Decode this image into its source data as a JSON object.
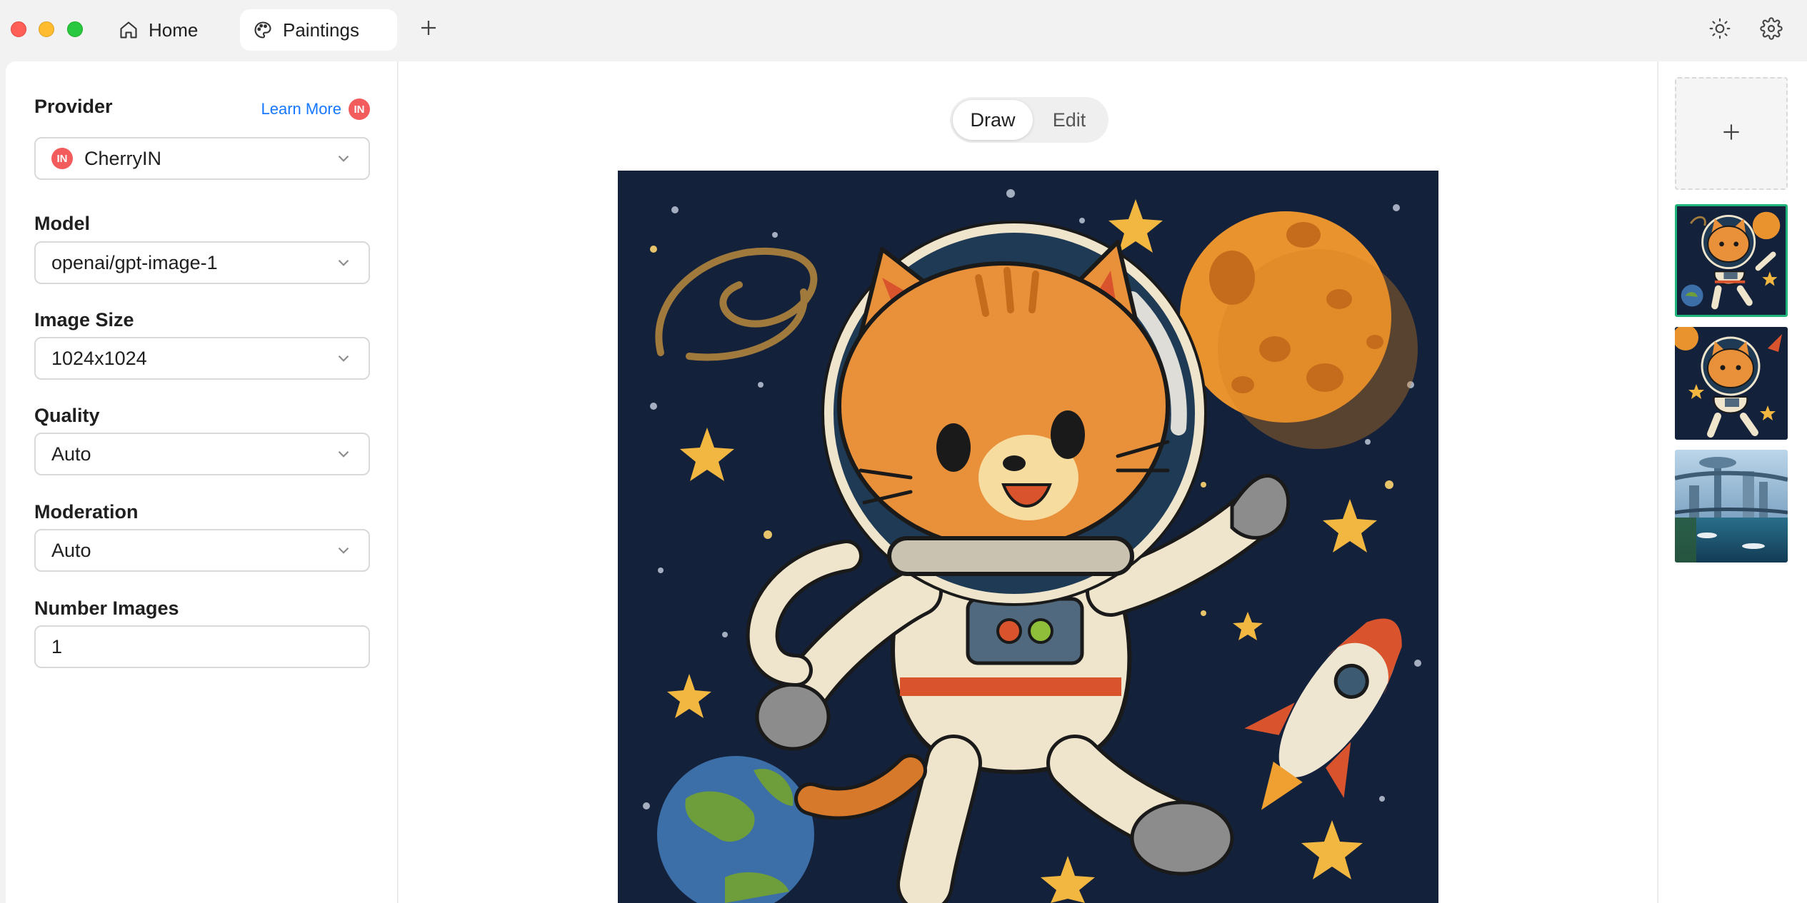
{
  "tabs": [
    {
      "label": "Home",
      "icon": "home-icon"
    },
    {
      "label": "Paintings",
      "icon": "palette-icon",
      "active": true
    }
  ],
  "header": {
    "add_tab_icon": "plus-icon",
    "theme_icon": "sun-icon",
    "settings_icon": "gear-icon"
  },
  "sidebar": {
    "provider": {
      "label": "Provider",
      "learn_more": "Learn More",
      "badge": "IN",
      "value": "CherryIN"
    },
    "model": {
      "label": "Model",
      "value": "openai/gpt-image-1"
    },
    "image_size": {
      "label": "Image Size",
      "value": "1024x1024"
    },
    "quality": {
      "label": "Quality",
      "value": "Auto"
    },
    "moderation": {
      "label": "Moderation",
      "value": "Auto"
    },
    "number_images": {
      "label": "Number Images",
      "value": "1"
    }
  },
  "mode": {
    "draw": "Draw",
    "edit": "Edit",
    "active": "Draw"
  },
  "gallery": {
    "add_icon": "plus-icon",
    "thumbnails": [
      {
        "name": "cat-astronaut-1",
        "selected": true
      },
      {
        "name": "cat-astronaut-2",
        "selected": false
      },
      {
        "name": "futuristic-city",
        "selected": false
      }
    ]
  },
  "colors": {
    "accent_link": "#1677ff",
    "badge": "#f25c5c",
    "selected_border": "#1fb57a",
    "space_bg": "#14213a"
  }
}
